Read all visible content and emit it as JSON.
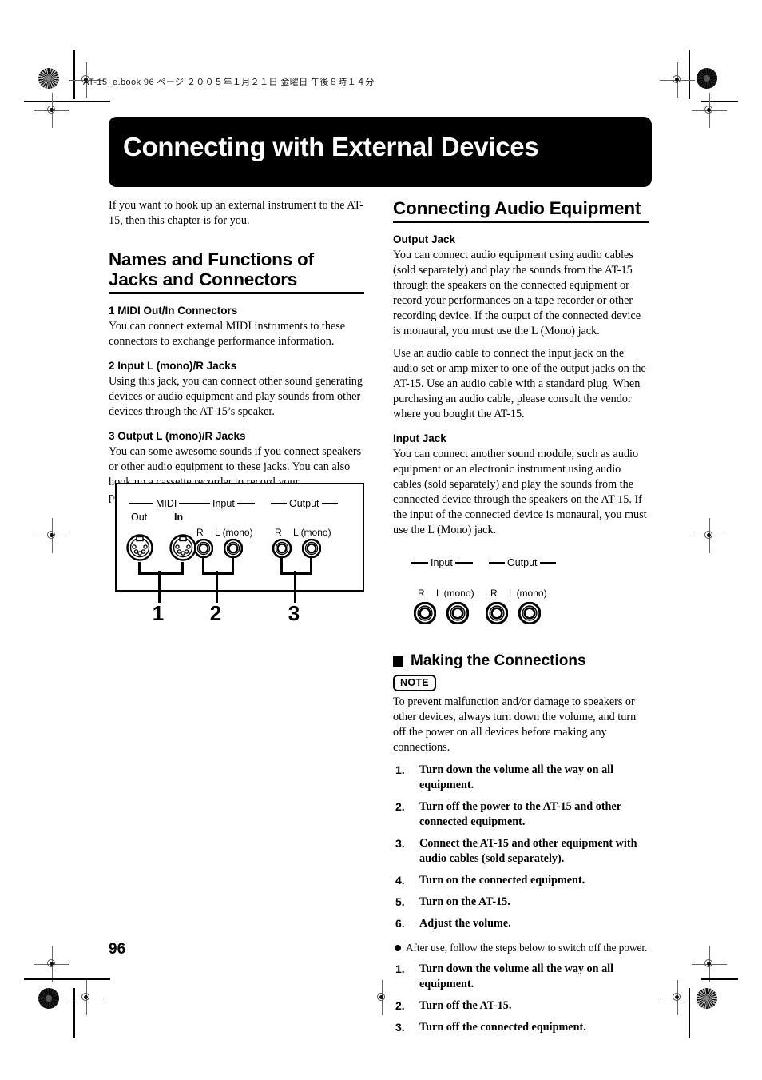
{
  "header": {
    "file_line": "AT-15_e.book  96 ページ  ２００５年１月２１日  金曜日  午後８時１４分"
  },
  "banner": {
    "chapter_title": "Connecting with External Devices"
  },
  "left_column": {
    "intro": "If you want to hook up an external instrument to the AT-15, then this chapter is for you.",
    "section_title": "Names and Functions of Jacks and Connectors",
    "entries": [
      {
        "heading": "1 MIDI Out/In Connectors",
        "body": "You can connect external MIDI instruments to these connectors to exchange performance information."
      },
      {
        "heading": "2 Input L (mono)/R Jacks",
        "body": "Using this jack, you can connect other sound generating devices or audio equipment and play sounds from other devices through the AT-15’s speaker."
      },
      {
        "heading": "3 Output L (mono)/R Jacks",
        "body": "You can some awesome sounds if you connect speakers or other audio equipment to these jacks. You can also hook up a cassette recorder to record your performances."
      }
    ]
  },
  "panel_diagram": {
    "group_midi": "MIDI",
    "group_input": "Input",
    "group_output": "Output",
    "midi_out": "Out",
    "midi_in": "In",
    "jack_r": "R",
    "jack_l": "L (mono)",
    "callouts": [
      "1",
      "2",
      "3"
    ]
  },
  "right_column": {
    "section_title": "Connecting Audio Equipment",
    "output_jack": {
      "heading": "Output Jack",
      "paragraph1": "You can connect audio equipment using audio cables (sold separately) and play the sounds from the AT-15 through the speakers on the connected equipment or record your performances on a tape recorder or other recording device. If the output of the connected device is monaural, you must use the L (Mono) jack.",
      "paragraph2": "Use an audio cable to connect the input jack on the audio set or amp mixer to one of the output jacks on the AT-15. Use an audio cable with a standard plug. When purchasing an audio cable, please consult the vendor where you bought the AT-15."
    },
    "input_jack": {
      "heading": "Input Jack",
      "paragraph1": "You can connect another sound module, such as audio equipment or an electronic instrument using audio cables (sold separately) and play the sounds from the connected device through the speakers on the AT-15. If the input of the connected device is monaural, you must use the L (Mono) jack."
    },
    "mini_diagram": {
      "group_input": "Input",
      "group_output": "Output",
      "jack_r": "R",
      "jack_l": "L (mono)"
    },
    "making_connections": {
      "heading": "Making the Connections",
      "note_label": "NOTE",
      "note_text": "To prevent malfunction and/or damage to speakers or other devices, always turn down the volume, and turn off the power on all devices before making any connections.",
      "steps_on": [
        {
          "num": "1.",
          "text": "Turn down the volume all the way on all equipment."
        },
        {
          "num": "2.",
          "text": "Turn off the power to the AT-15 and other connected equipment."
        },
        {
          "num": "3.",
          "text": "Connect the AT-15 and other equipment with audio cables (sold separately)."
        },
        {
          "num": "4.",
          "text": "Turn on the connected equipment."
        },
        {
          "num": "5.",
          "text": "Turn on the AT-15."
        },
        {
          "num": "6.",
          "text": "Adjust the volume."
        }
      ],
      "after_use_note": "After use, follow the steps below to switch off the power.",
      "steps_off": [
        {
          "num": "1.",
          "text": "Turn down the volume all the way on all equipment."
        },
        {
          "num": "2.",
          "text": "Turn off the AT-15."
        },
        {
          "num": "3.",
          "text": "Turn off the connected equipment."
        }
      ]
    }
  },
  "footer": {
    "page_number": "96"
  }
}
